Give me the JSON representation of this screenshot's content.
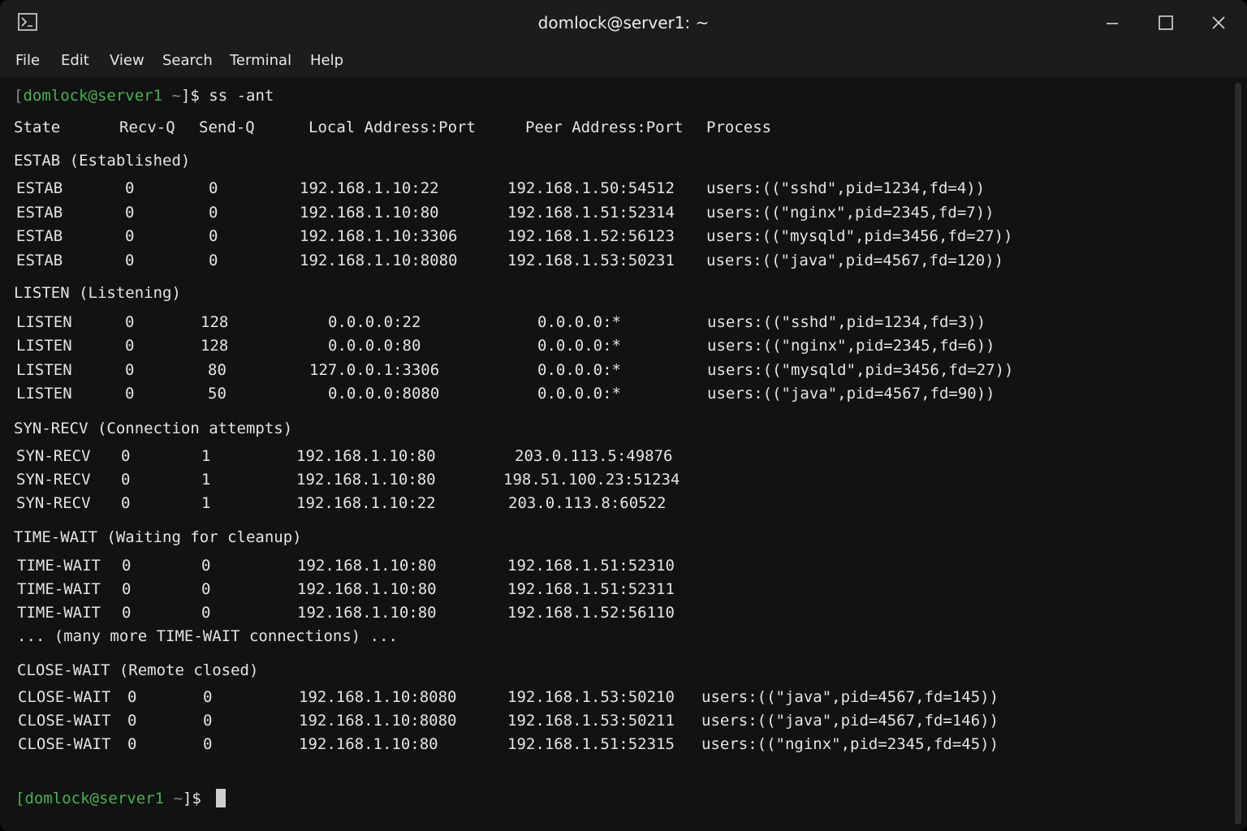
{
  "window": {
    "title": "domlock@server1: ~",
    "icons": {
      "app": "terminal-icon",
      "minimize": "minimize-icon",
      "maximize": "maximize-icon",
      "close": "close-icon"
    }
  },
  "menu": [
    "File",
    "Edit",
    "View",
    "Search",
    "Terminal",
    "Help"
  ],
  "prompt": {
    "open": "[",
    "userhost": "domlock@server1",
    "dir": " ~",
    "close": "]$ ",
    "command": "ss -ant"
  },
  "headers": [
    "State",
    "Recv-Q",
    "Send-Q",
    "Local Address:Port",
    "Peer Address:Port",
    "Process"
  ],
  "sections": [
    {
      "title": "ESTAB (Established)",
      "rows": [
        [
          "ESTAB",
          "0",
          "0",
          "192.168.1.10:22",
          "192.168.1.50:54512",
          "users:((\"sshd\",pid=1234,fd=4))"
        ],
        [
          "ESTAB",
          "0",
          "0",
          "192.168.1.10:80",
          "192.168.1.51:52314",
          "users:((\"nginx\",pid=2345,fd=7))"
        ],
        [
          "ESTAB",
          "0",
          "0",
          "192.168.1.10:3306",
          "192.168.1.52:56123",
          "users:((\"mysqld\",pid=3456,fd=27))"
        ],
        [
          "ESTAB",
          "0",
          "0",
          "192.168.1.10:8080",
          "192.168.1.53:50231",
          "users:((\"java\",pid=4567,fd=120))"
        ]
      ]
    },
    {
      "title": "LISTEN (Listening)",
      "rows": [
        [
          "LISTEN",
          "0",
          "128",
          "0.0.0.0:22",
          "0.0.0.0:*",
          "users:((\"sshd\",pid=1234,fd=3))"
        ],
        [
          "LISTEN",
          "0",
          "128",
          "0.0.0.0:80",
          "0.0.0.0:*",
          "users:((\"nginx\",pid=2345,fd=6))"
        ],
        [
          "LISTEN",
          "0",
          "80",
          "127.0.0.1:3306",
          "0.0.0.0:*",
          "users:((\"mysqld\",pid=3456,fd=27))"
        ],
        [
          "LISTEN",
          "0",
          "50",
          "0.0.0.0:8080",
          "0.0.0.0:*",
          "users:((\"java\",pid=4567,fd=90))"
        ]
      ]
    },
    {
      "title": "SYN-RECV (Connection attempts)",
      "rows": [
        [
          "SYN-RECV",
          "0",
          "1",
          "192.168.1.10:80",
          "203.0.113.5:49876",
          ""
        ],
        [
          "SYN-RECV",
          "0",
          "1",
          "192.168.1.10:80",
          "198.51.100.23:51234",
          ""
        ],
        [
          "SYN-RECV",
          "0",
          "1",
          "192.168.1.10:22",
          "203.0.113.8:60522",
          ""
        ]
      ]
    },
    {
      "title": "TIME-WAIT (Waiting for cleanup)",
      "rows": [
        [
          "TIME-WAIT",
          "0",
          "0",
          "192.168.1.10:80",
          "192.168.1.51:52310",
          ""
        ],
        [
          "TIME-WAIT",
          "0",
          "0",
          "192.168.1.10:80",
          "192.168.1.51:52311",
          ""
        ],
        [
          "TIME-WAIT",
          "0",
          "0",
          "192.168.1.10:80",
          "192.168.1.52:56110",
          ""
        ]
      ],
      "note": "... (many more TIME-WAIT connections) ..."
    },
    {
      "title": "CLOSE-WAIT (Remote closed)",
      "rows": [
        [
          "CLOSE-WAIT",
          "0",
          "0",
          "192.168.1.10:8080",
          "192.168.1.53:50210",
          "users:((\"java\",pid=4567,fd=145))"
        ],
        [
          "CLOSE-WAIT",
          "0",
          "0",
          "192.168.1.10:8080",
          "192.168.1.53:50211",
          "users:((\"java\",pid=4567,fd=146))"
        ],
        [
          "CLOSE-WAIT",
          "0",
          "0",
          "192.168.1.10:80",
          "192.168.1.51:52315",
          "users:((\"nginx\",pid=2345,fd=45))"
        ]
      ]
    }
  ]
}
